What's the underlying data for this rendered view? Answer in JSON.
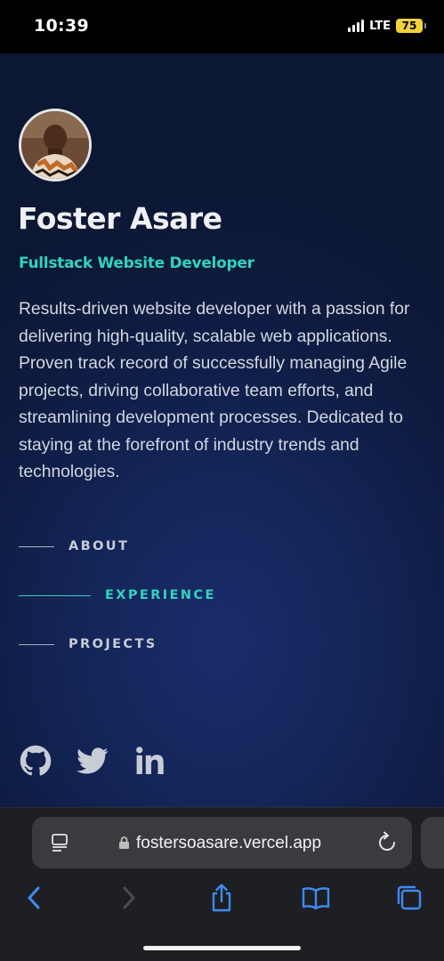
{
  "status_bar": {
    "time": "10:39",
    "network": "LTE",
    "battery": "75"
  },
  "profile": {
    "name": "Foster Asare",
    "role": "Fullstack Website Developer",
    "bio": "Results-driven website developer with a passion for delivering high-quality, scalable web applications. Proven track record of successfully managing Agile projects, driving collaborative team efforts, and streamlining development processes. Dedicated to staying at the forefront of industry trends and technologies."
  },
  "nav": {
    "items": [
      {
        "label": "ABOUT",
        "active": false
      },
      {
        "label": "EXPERIENCE",
        "active": true
      },
      {
        "label": "PROJECTS",
        "active": false
      }
    ]
  },
  "socials": [
    "github-icon",
    "twitter-icon",
    "linkedin-icon"
  ],
  "browser": {
    "url": "fostersoasare.vercel.app"
  },
  "colors": {
    "accent": "#2fd4bf",
    "background": "#0f1d42",
    "toolbar_icon": "#3d8bf5"
  }
}
